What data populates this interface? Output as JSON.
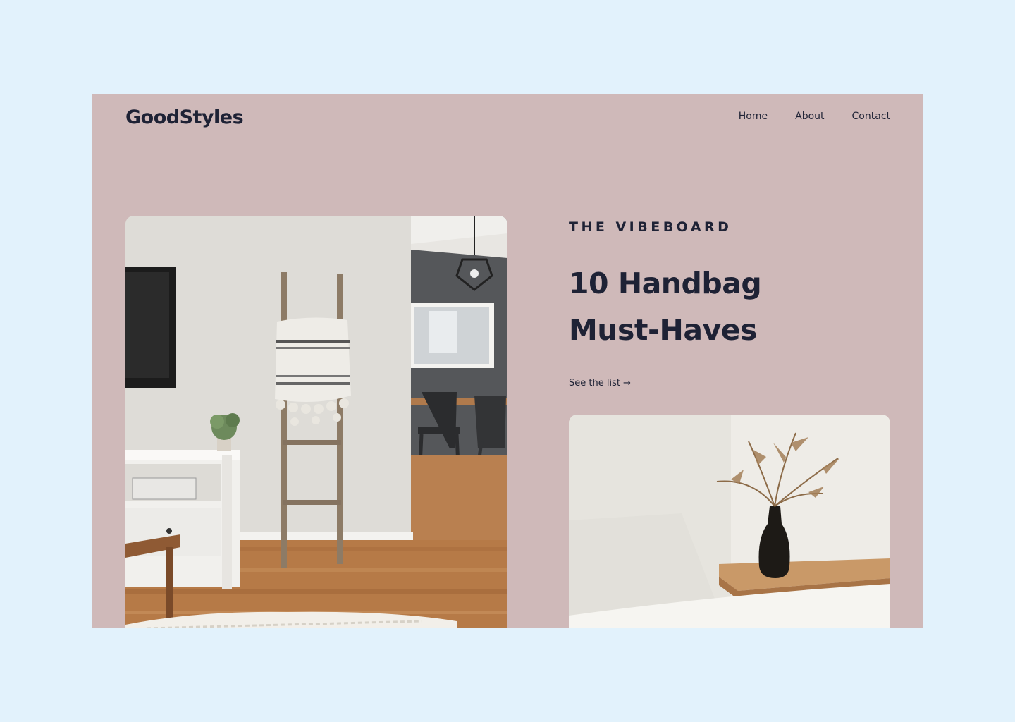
{
  "brand": {
    "name": "GoodStyles"
  },
  "nav": {
    "items": [
      {
        "label": "Home"
      },
      {
        "label": "About"
      },
      {
        "label": "Contact"
      }
    ]
  },
  "hero": {
    "eyebrow": "THE VIBEBOARD",
    "headline_line1": "10 Handbag",
    "headline_line2": "Must-Haves",
    "cta_label": "See the list",
    "cta_arrow": "→"
  },
  "colors": {
    "page_background": "#e2f2fc",
    "frame_background": "#cfb9b9",
    "text_dark": "#1e2235"
  },
  "images": {
    "main_photo": "living-room-ladder-photo",
    "side_photo": "vase-with-dried-leaves-photo"
  }
}
